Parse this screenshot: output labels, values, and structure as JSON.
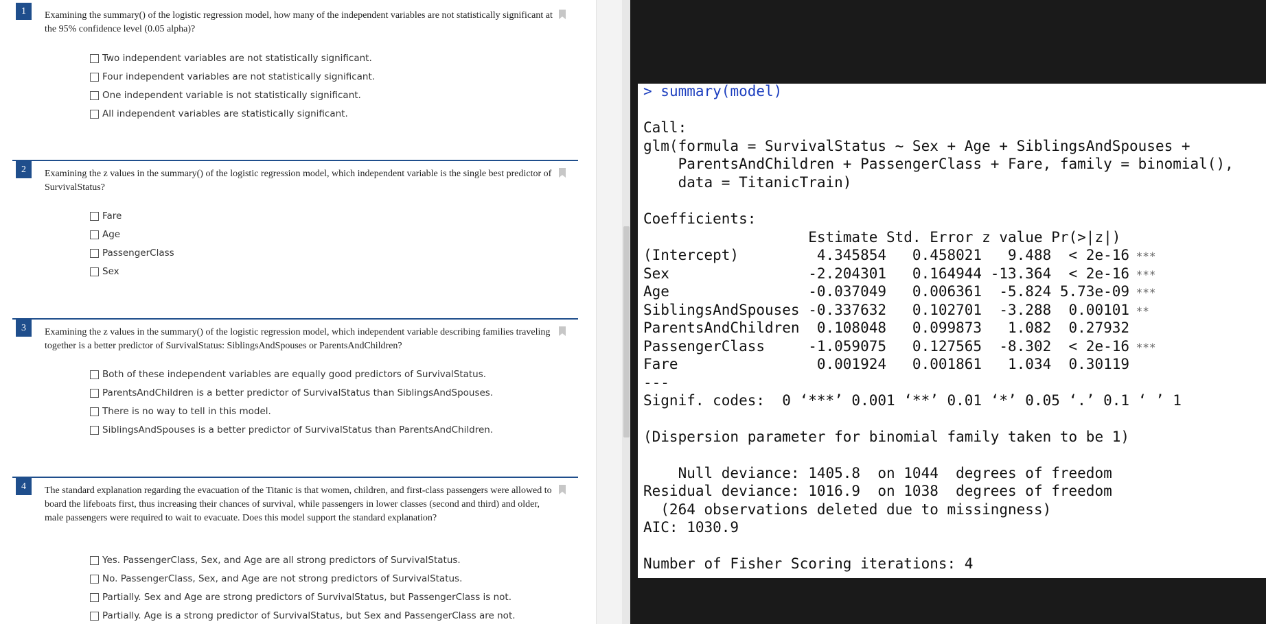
{
  "questions": [
    {
      "number": "1",
      "text": "Examining the summary() of the logistic regression model, how many of the independent variables are not statistically significant at the 95% confidence level (0.05 alpha)?",
      "options": [
        "Two independent variables are not statistically significant.",
        "Four independent variables are not statistically significant.",
        "One independent variable is not statistically significant.",
        "All independent variables are statistically significant."
      ]
    },
    {
      "number": "2",
      "text": "Examining the z values in the summary() of the logistic regression model, which independent variable is the single best predictor of SurvivalStatus?",
      "options": [
        "Fare",
        "Age",
        "PassengerClass",
        "Sex"
      ]
    },
    {
      "number": "3",
      "text": "Examining the z values in the summary() of the logistic regression model, which independent variable describing families traveling together is a better predictor of SurvivalStatus: SiblingsAndSpouses or ParentsAndChildren?",
      "options": [
        "Both of these independent variables are equally good predictors of SurvivalStatus.",
        "ParentsAndChildren is a better predictor of SurvivalStatus than SiblingsAndSpouses.",
        "There is no way to tell in this model.",
        "SiblingsAndSpouses is a better predictor of SurvivalStatus than ParentsAndChildren."
      ]
    },
    {
      "number": "4",
      "text": "The standard explanation regarding the evacuation of the Titanic is that women, children, and first-class passengers were allowed to board the lifeboats first, thus increasing their chances of survival, while passengers in lower classes (second and third) and older, male passengers were required to wait to evacuate. Does this model support the standard explanation?",
      "options": [
        "Yes. PassengerClass, Sex, and Age are all strong predictors of SurvivalStatus.",
        "No. PassengerClass, Sex, and Age are not strong predictors of SurvivalStatus.",
        "Partially. Sex and Age are strong predictors of SurvivalStatus, but PassengerClass is not.",
        "Partially. Age is a strong predictor of SurvivalStatus, but Sex and PassengerClass are not."
      ]
    }
  ],
  "console": {
    "prompt": ">",
    "command": " summary(model)",
    "call_label": "Call:",
    "call_lines": [
      "glm(formula = SurvivalStatus ~ Sex + Age + SiblingsAndSpouses +",
      "    ParentsAndChildren + PassengerClass + Fare, family = binomial(),",
      "    data = TitanicTrain)"
    ],
    "coef_label": "Coefficients:",
    "coef_header": "                   Estimate Std. Error z value Pr(>|z|)",
    "coef_rows": [
      {
        "text": "(Intercept)         4.345854   0.458021   9.488  < 2e-16",
        "stars": " ***"
      },
      {
        "text": "Sex                -2.204301   0.164944 -13.364  < 2e-16",
        "stars": " ***"
      },
      {
        "text": "Age                -0.037049   0.006361  -5.824 5.73e-09",
        "stars": " ***"
      },
      {
        "text": "SiblingsAndSpouses -0.337632   0.102701  -3.288  0.00101",
        "stars": " **"
      },
      {
        "text": "ParentsAndChildren  0.108048   0.099873   1.082  0.27932",
        "stars": ""
      },
      {
        "text": "PassengerClass     -1.059075   0.127565  -8.302  < 2e-16",
        "stars": " ***"
      },
      {
        "text": "Fare                0.001924   0.001861   1.034  0.30119",
        "stars": ""
      }
    ],
    "separator": "---",
    "signif": "Signif. codes:  0 ‘***’ 0.001 ‘**’ 0.01 ‘*’ 0.05 ‘.’ 0.1 ‘ ’ 1",
    "dispersion": "(Dispersion parameter for binomial family taken to be 1)",
    "null_deviance": "    Null deviance: 1405.8  on 1044  degrees of freedom",
    "residual_deviance": "Residual deviance: 1016.9  on 1038  degrees of freedom",
    "missingness": "  (264 observations deleted due to missingness)",
    "aic": "AIC: 1030.9",
    "fisher": "Number of Fisher Scoring iterations: 4"
  }
}
